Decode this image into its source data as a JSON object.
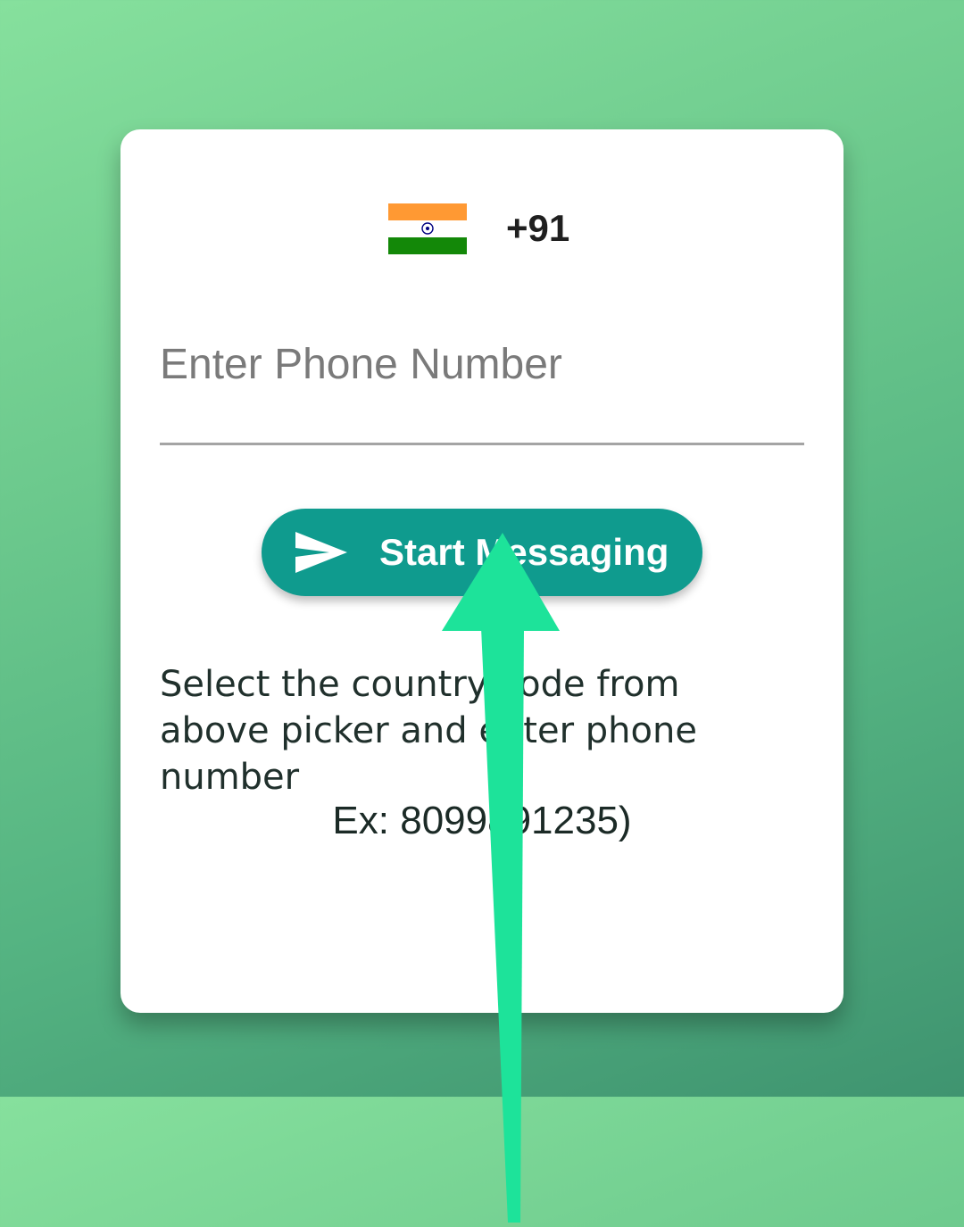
{
  "country_picker": {
    "dial_code": "+91",
    "flag_icon": "india-flag-icon",
    "flag_colors": [
      "#FF9933",
      "#FFFFFF",
      "#138808"
    ],
    "chakra_color": "#000080"
  },
  "phone_input": {
    "placeholder": "Enter Phone Number",
    "value": ""
  },
  "start_button": {
    "label": "Start Messaging",
    "icon": "send-icon",
    "color": "#0f9b8e"
  },
  "hint": {
    "text": "Select the country code from above picker and enter phone number",
    "example": "Ex: 8099891235)"
  },
  "overlay": {
    "icon": "swipe-up-arrow-icon",
    "color": "#1de39a"
  }
}
